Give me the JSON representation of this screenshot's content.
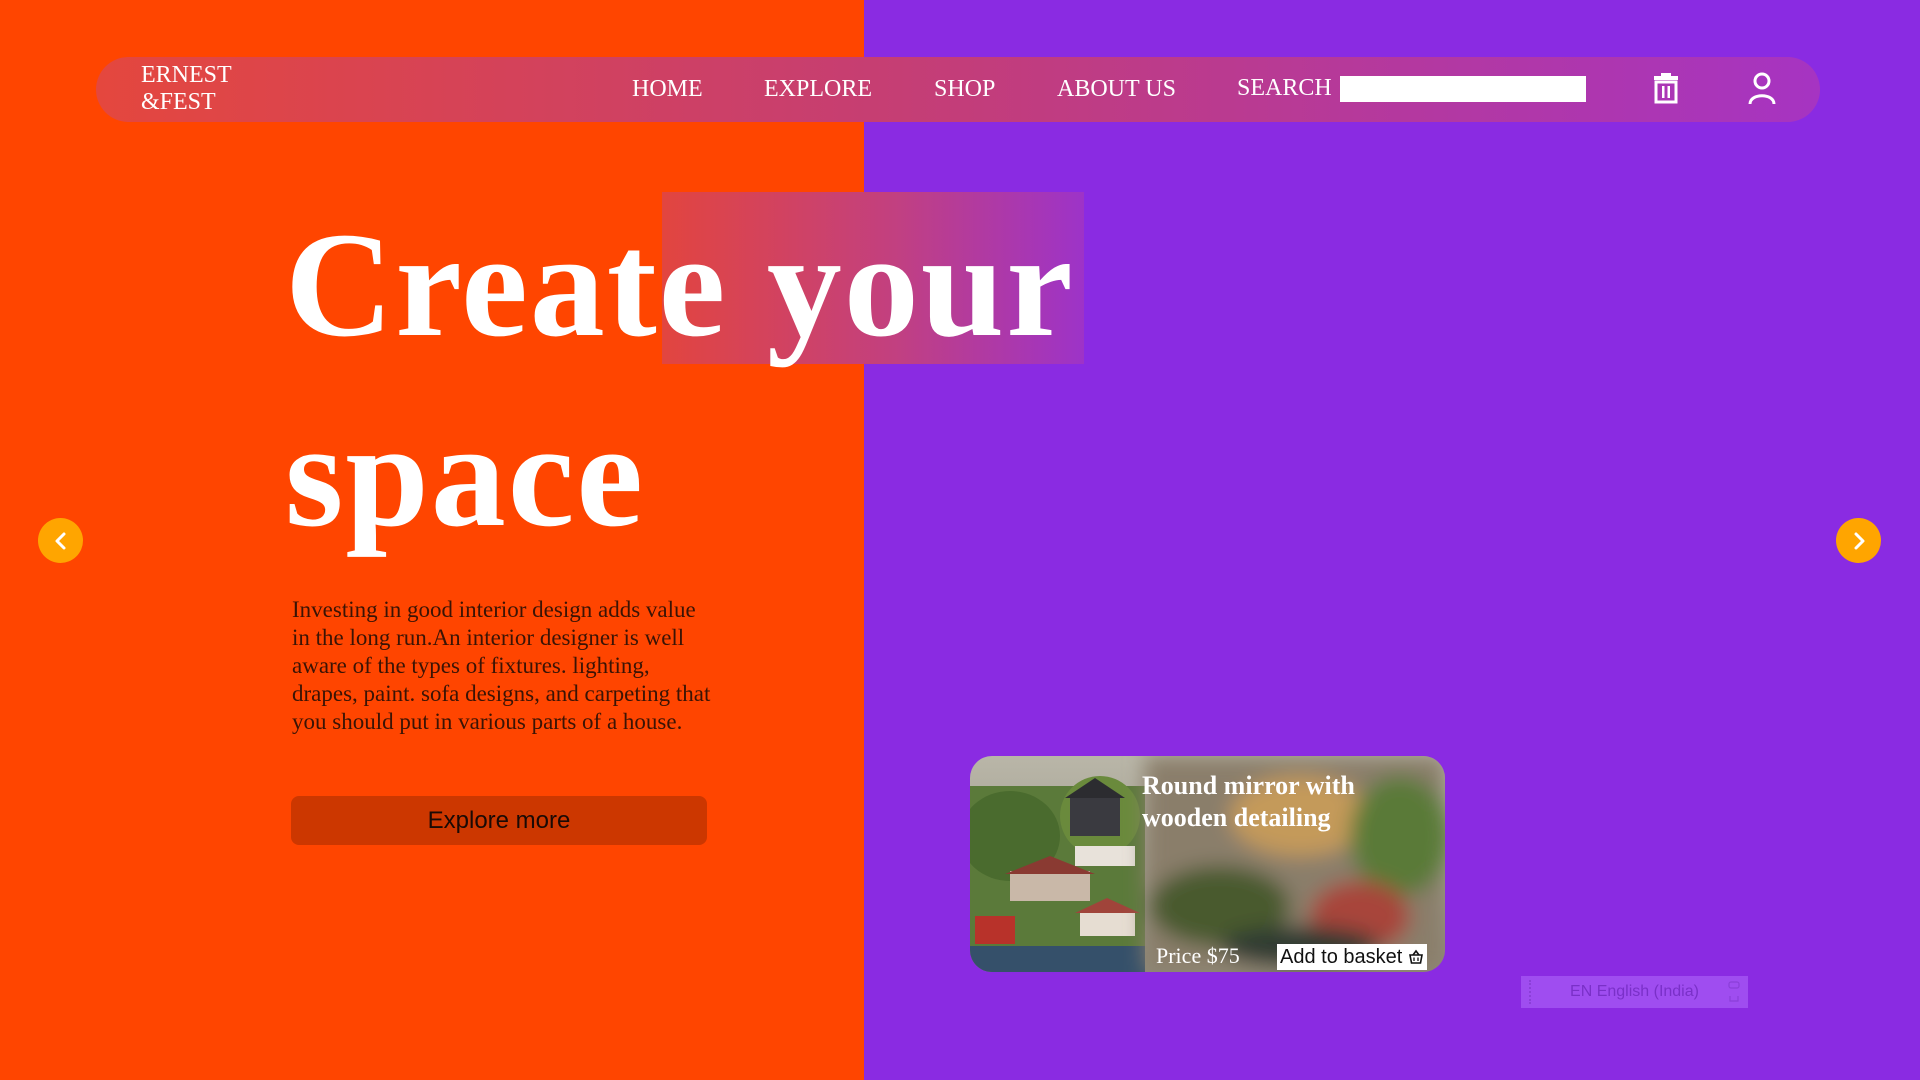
{
  "colors": {
    "left_bg": "#ff4500",
    "right_bg": "#8a2be2",
    "accent": "#ffa500",
    "button": "#cc3700"
  },
  "brand": {
    "name": "ERNEST\n&FEST"
  },
  "nav": {
    "items": [
      "HOME",
      "EXPLORE",
      "SHOP",
      "ABOUT US"
    ],
    "search_label": "SEARCH",
    "search_value": "",
    "cart_icon": "trash-basket-icon",
    "user_icon": "user-icon"
  },
  "hero": {
    "title_line1": "Create your",
    "title_line2": "space",
    "description": "Investing in good interior design adds value in the long run.An interior designer is well aware of the types of fixtures. lighting, drapes, paint. sofa designs, and carpeting that you should put in various parts of a house.",
    "cta": "Explore more"
  },
  "carousel": {
    "prev_icon": "chevron-left-icon",
    "next_icon": "chevron-right-icon"
  },
  "product": {
    "title": "Round mirror with wooden detailing",
    "price": "Price $75",
    "basket_label": "Add to basket",
    "basket_icon": "basket-icon"
  },
  "language_bar": {
    "label": "EN English (India)"
  }
}
